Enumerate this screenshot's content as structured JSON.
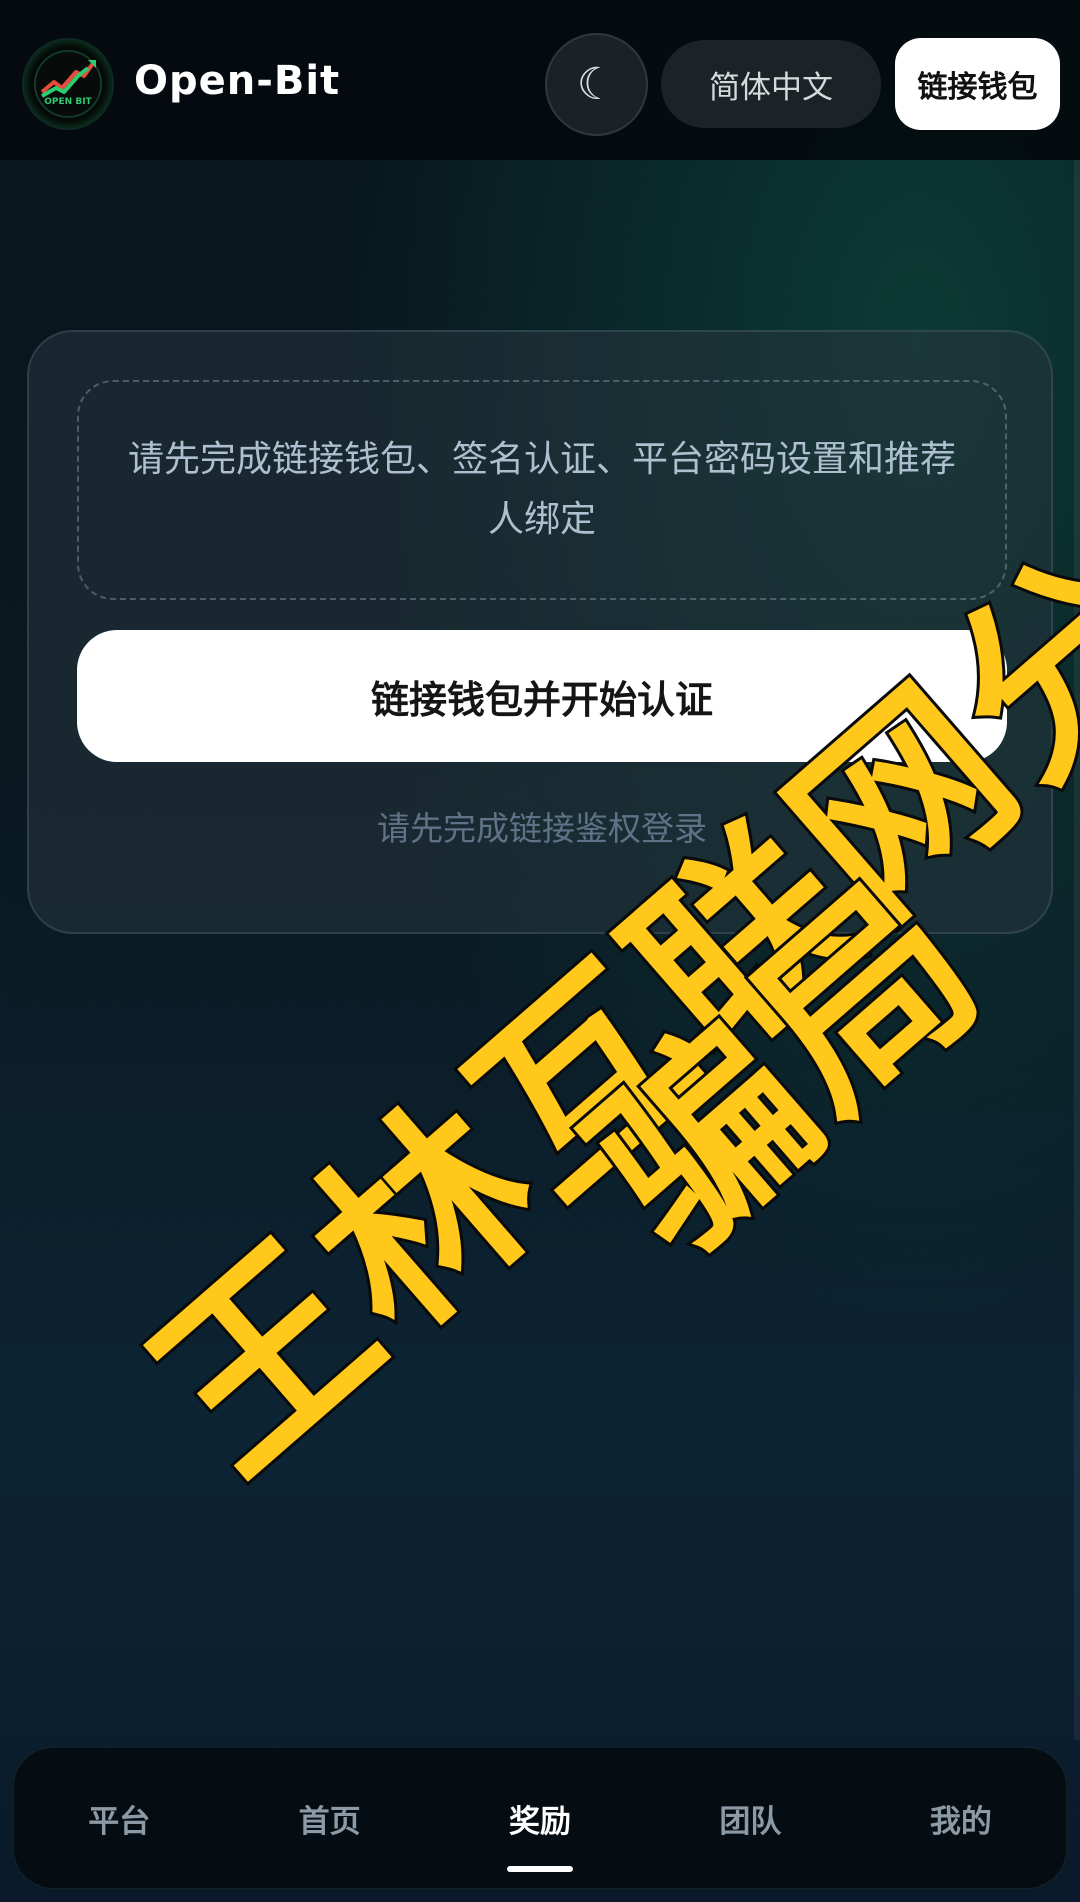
{
  "header": {
    "brand": "Open-Bit",
    "logo_text": "OPEN BIT",
    "theme_icon": "moon-icon",
    "language": "简体中文",
    "wallet_button": "链接钱包"
  },
  "card": {
    "notice": "请先完成链接钱包、签名认证、平台密码设置和推荐人绑定",
    "cta_button": "链接钱包并开始认证",
    "hint": "请先完成链接鉴权登录"
  },
  "watermark": {
    "line1": "王林互联网分析",
    "line2": "骗局"
  },
  "bottom_nav": {
    "items": [
      {
        "label": "平台",
        "active": false
      },
      {
        "label": "首页",
        "active": false
      },
      {
        "label": "奖励",
        "active": true
      },
      {
        "label": "团队",
        "active": false
      },
      {
        "label": "我的",
        "active": false
      }
    ]
  },
  "colors": {
    "accent": "#ffc81a",
    "logo_green": "#2ecc71",
    "logo_red": "#e74c3c"
  }
}
